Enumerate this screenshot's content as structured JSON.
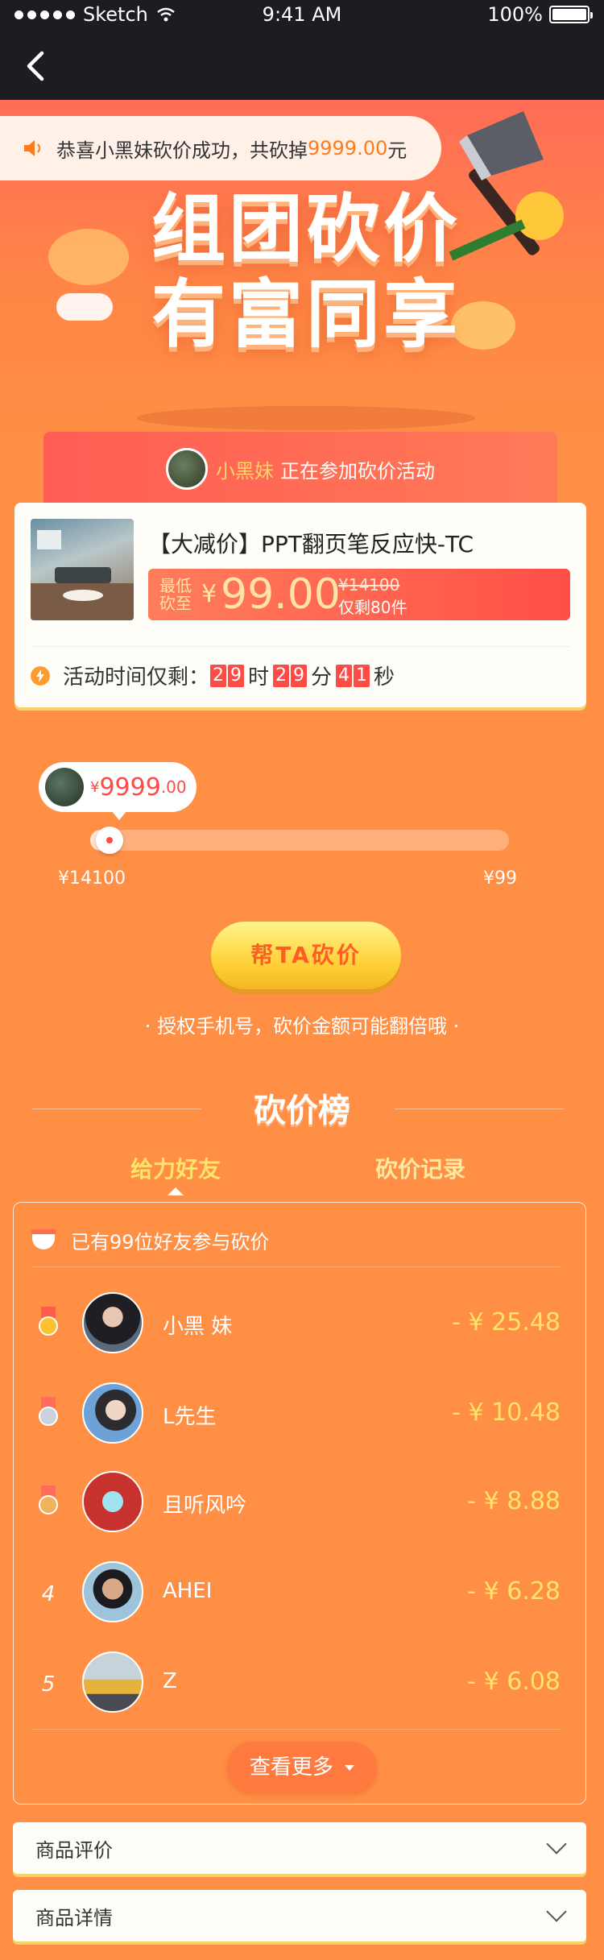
{
  "status_bar": {
    "carrier": "Sketch",
    "time": "9:41 AM",
    "battery": "100%"
  },
  "notice": {
    "prefix": "恭喜小黑妹砍价成功，共砍掉",
    "amount": "9999.00",
    "suffix": "元"
  },
  "hero": {
    "title_line1": "组团砍价",
    "title_line2": "有富同享"
  },
  "participant": {
    "name": "小黑妹",
    "text": "正在参加砍价活动"
  },
  "product": {
    "title": "【大减价】PPT翻页笔反应快-TC",
    "price_label_1": "最低",
    "price_label_2": "砍至",
    "yen": "¥",
    "price": "99.00",
    "original_price": "¥14100",
    "stock": "仅剩80件",
    "timer_label": "活动时间仅剩：",
    "hours": [
      "2",
      "9"
    ],
    "hours_unit": "时",
    "minutes": [
      "2",
      "9"
    ],
    "minutes_unit": "分",
    "seconds": [
      "4",
      "1"
    ],
    "seconds_unit": "秒"
  },
  "progress": {
    "bubble_yen": "¥",
    "bubble_value": "9999",
    "bubble_decimal": ".00",
    "fraction": 0.04,
    "min_label": "¥14100",
    "max_label": "¥99"
  },
  "cta": {
    "label": "帮TA砍价"
  },
  "hint": {
    "text": "·   授权手机号，砍价金额可能翻倍哦   ·"
  },
  "leaderboard": {
    "title": "砍价榜",
    "tabs": [
      {
        "label": "给力好友"
      },
      {
        "label": "砍价记录"
      }
    ],
    "summary": "已有99位好友参与砍价",
    "rows": [
      {
        "rank": "1",
        "name": "小黑 妹",
        "amount": "- ¥ 25.48",
        "medal": "gold-medal-icon"
      },
      {
        "rank": "2",
        "name": "L先生",
        "amount": "- ¥ 10.48",
        "medal": "silver-medal-icon"
      },
      {
        "rank": "3",
        "name": "且听风吟",
        "amount": "- ¥ 8.88",
        "medal": "bronze-medal-icon"
      },
      {
        "rank": "4",
        "name": "AHEI",
        "amount": "- ¥ 6.28"
      },
      {
        "rank": "5",
        "name": "Z",
        "amount": "- ¥ 6.08"
      }
    ],
    "more_label": "查看更多"
  },
  "sections": [
    {
      "label": "商品评价"
    },
    {
      "label": "商品详情"
    }
  ],
  "colors": {
    "accent": "#ff4b45",
    "background": "#ff8f45",
    "highlight": "#ffe36a"
  }
}
